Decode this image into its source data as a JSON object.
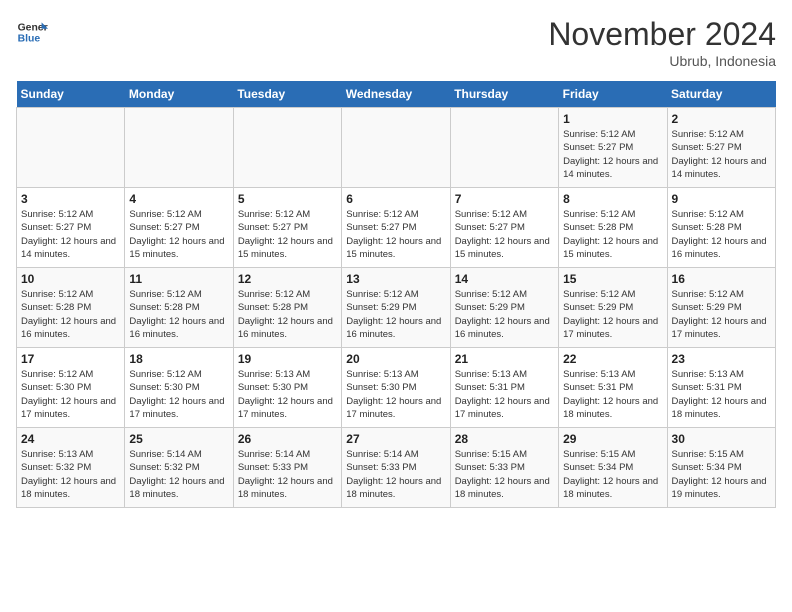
{
  "header": {
    "logo_line1": "General",
    "logo_line2": "Blue",
    "month_title": "November 2024",
    "subtitle": "Ubrub, Indonesia"
  },
  "weekdays": [
    "Sunday",
    "Monday",
    "Tuesday",
    "Wednesday",
    "Thursday",
    "Friday",
    "Saturday"
  ],
  "weeks": [
    [
      {
        "day": "",
        "sunrise": "",
        "sunset": "",
        "daylight": ""
      },
      {
        "day": "",
        "sunrise": "",
        "sunset": "",
        "daylight": ""
      },
      {
        "day": "",
        "sunrise": "",
        "sunset": "",
        "daylight": ""
      },
      {
        "day": "",
        "sunrise": "",
        "sunset": "",
        "daylight": ""
      },
      {
        "day": "",
        "sunrise": "",
        "sunset": "",
        "daylight": ""
      },
      {
        "day": "1",
        "sunrise": "Sunrise: 5:12 AM",
        "sunset": "Sunset: 5:27 PM",
        "daylight": "Daylight: 12 hours and 14 minutes."
      },
      {
        "day": "2",
        "sunrise": "Sunrise: 5:12 AM",
        "sunset": "Sunset: 5:27 PM",
        "daylight": "Daylight: 12 hours and 14 minutes."
      }
    ],
    [
      {
        "day": "3",
        "sunrise": "Sunrise: 5:12 AM",
        "sunset": "Sunset: 5:27 PM",
        "daylight": "Daylight: 12 hours and 14 minutes."
      },
      {
        "day": "4",
        "sunrise": "Sunrise: 5:12 AM",
        "sunset": "Sunset: 5:27 PM",
        "daylight": "Daylight: 12 hours and 15 minutes."
      },
      {
        "day": "5",
        "sunrise": "Sunrise: 5:12 AM",
        "sunset": "Sunset: 5:27 PM",
        "daylight": "Daylight: 12 hours and 15 minutes."
      },
      {
        "day": "6",
        "sunrise": "Sunrise: 5:12 AM",
        "sunset": "Sunset: 5:27 PM",
        "daylight": "Daylight: 12 hours and 15 minutes."
      },
      {
        "day": "7",
        "sunrise": "Sunrise: 5:12 AM",
        "sunset": "Sunset: 5:27 PM",
        "daylight": "Daylight: 12 hours and 15 minutes."
      },
      {
        "day": "8",
        "sunrise": "Sunrise: 5:12 AM",
        "sunset": "Sunset: 5:28 PM",
        "daylight": "Daylight: 12 hours and 15 minutes."
      },
      {
        "day": "9",
        "sunrise": "Sunrise: 5:12 AM",
        "sunset": "Sunset: 5:28 PM",
        "daylight": "Daylight: 12 hours and 16 minutes."
      }
    ],
    [
      {
        "day": "10",
        "sunrise": "Sunrise: 5:12 AM",
        "sunset": "Sunset: 5:28 PM",
        "daylight": "Daylight: 12 hours and 16 minutes."
      },
      {
        "day": "11",
        "sunrise": "Sunrise: 5:12 AM",
        "sunset": "Sunset: 5:28 PM",
        "daylight": "Daylight: 12 hours and 16 minutes."
      },
      {
        "day": "12",
        "sunrise": "Sunrise: 5:12 AM",
        "sunset": "Sunset: 5:28 PM",
        "daylight": "Daylight: 12 hours and 16 minutes."
      },
      {
        "day": "13",
        "sunrise": "Sunrise: 5:12 AM",
        "sunset": "Sunset: 5:29 PM",
        "daylight": "Daylight: 12 hours and 16 minutes."
      },
      {
        "day": "14",
        "sunrise": "Sunrise: 5:12 AM",
        "sunset": "Sunset: 5:29 PM",
        "daylight": "Daylight: 12 hours and 16 minutes."
      },
      {
        "day": "15",
        "sunrise": "Sunrise: 5:12 AM",
        "sunset": "Sunset: 5:29 PM",
        "daylight": "Daylight: 12 hours and 17 minutes."
      },
      {
        "day": "16",
        "sunrise": "Sunrise: 5:12 AM",
        "sunset": "Sunset: 5:29 PM",
        "daylight": "Daylight: 12 hours and 17 minutes."
      }
    ],
    [
      {
        "day": "17",
        "sunrise": "Sunrise: 5:12 AM",
        "sunset": "Sunset: 5:30 PM",
        "daylight": "Daylight: 12 hours and 17 minutes."
      },
      {
        "day": "18",
        "sunrise": "Sunrise: 5:12 AM",
        "sunset": "Sunset: 5:30 PM",
        "daylight": "Daylight: 12 hours and 17 minutes."
      },
      {
        "day": "19",
        "sunrise": "Sunrise: 5:13 AM",
        "sunset": "Sunset: 5:30 PM",
        "daylight": "Daylight: 12 hours and 17 minutes."
      },
      {
        "day": "20",
        "sunrise": "Sunrise: 5:13 AM",
        "sunset": "Sunset: 5:30 PM",
        "daylight": "Daylight: 12 hours and 17 minutes."
      },
      {
        "day": "21",
        "sunrise": "Sunrise: 5:13 AM",
        "sunset": "Sunset: 5:31 PM",
        "daylight": "Daylight: 12 hours and 17 minutes."
      },
      {
        "day": "22",
        "sunrise": "Sunrise: 5:13 AM",
        "sunset": "Sunset: 5:31 PM",
        "daylight": "Daylight: 12 hours and 18 minutes."
      },
      {
        "day": "23",
        "sunrise": "Sunrise: 5:13 AM",
        "sunset": "Sunset: 5:31 PM",
        "daylight": "Daylight: 12 hours and 18 minutes."
      }
    ],
    [
      {
        "day": "24",
        "sunrise": "Sunrise: 5:13 AM",
        "sunset": "Sunset: 5:32 PM",
        "daylight": "Daylight: 12 hours and 18 minutes."
      },
      {
        "day": "25",
        "sunrise": "Sunrise: 5:14 AM",
        "sunset": "Sunset: 5:32 PM",
        "daylight": "Daylight: 12 hours and 18 minutes."
      },
      {
        "day": "26",
        "sunrise": "Sunrise: 5:14 AM",
        "sunset": "Sunset: 5:33 PM",
        "daylight": "Daylight: 12 hours and 18 minutes."
      },
      {
        "day": "27",
        "sunrise": "Sunrise: 5:14 AM",
        "sunset": "Sunset: 5:33 PM",
        "daylight": "Daylight: 12 hours and 18 minutes."
      },
      {
        "day": "28",
        "sunrise": "Sunrise: 5:15 AM",
        "sunset": "Sunset: 5:33 PM",
        "daylight": "Daylight: 12 hours and 18 minutes."
      },
      {
        "day": "29",
        "sunrise": "Sunrise: 5:15 AM",
        "sunset": "Sunset: 5:34 PM",
        "daylight": "Daylight: 12 hours and 18 minutes."
      },
      {
        "day": "30",
        "sunrise": "Sunrise: 5:15 AM",
        "sunset": "Sunset: 5:34 PM",
        "daylight": "Daylight: 12 hours and 19 minutes."
      }
    ]
  ]
}
